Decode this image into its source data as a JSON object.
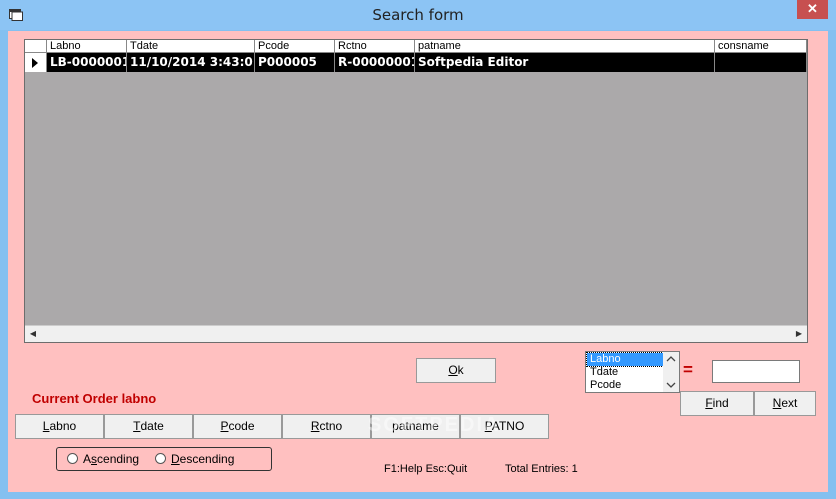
{
  "window": {
    "title": "Search form",
    "close_glyph": "✕",
    "colors": {
      "titlebar": "#8cc4f4",
      "client": "#ffc0c0",
      "accent_text": "#c00000",
      "close": "#c75050"
    }
  },
  "grid": {
    "columns": [
      "Labno",
      "Tdate",
      "Pcode",
      "Rctno",
      "patname",
      "consname"
    ],
    "rows": [
      {
        "cells": [
          "LB-0000001",
          "11/10/2014 3:43:0",
          "P000005",
          "R-00000001",
          "Softpedia Editor",
          ""
        ]
      }
    ],
    "scroll_left_glyph": "◀",
    "scroll_right_glyph": "▶"
  },
  "ok_button": {
    "label": "Ok",
    "mnemonic": "O",
    "rest": "k"
  },
  "current_order": "Current Order  labno",
  "sort_buttons": [
    {
      "label": "Labno",
      "u": "L",
      "rest": "abno"
    },
    {
      "label": "Tdate",
      "u": "T",
      "rest": "date"
    },
    {
      "label": "Pcode",
      "u": "P",
      "rest": "code"
    },
    {
      "label": "Rctno",
      "u": "R",
      "rest": "ctno"
    },
    {
      "label": "patname",
      "u": "",
      "rest": "patname"
    },
    {
      "label": "PATNO",
      "u": "P",
      "rest": "ATNO"
    }
  ],
  "order": {
    "ascending_label": "Ascending",
    "ascending_u": "s",
    "descending_label": "Descending",
    "descending_u": "D"
  },
  "search": {
    "fields": [
      "Labno",
      "Tdate",
      "Pcode"
    ],
    "selected": "Labno",
    "equals": "=",
    "value": "",
    "find_label": "Find",
    "find_u": "F",
    "next_label": "Next",
    "next_u": "N"
  },
  "status": {
    "help": "F1:Help  Esc:Quit",
    "total": "Total Entries: 1"
  },
  "watermark": "SOFTPEDIA",
  "icons": [
    "app-window-icon",
    "close-icon",
    "row-selector-arrow-icon",
    "scroll-left-icon",
    "scroll-right-icon",
    "scroll-up-icon",
    "scroll-down-icon"
  ]
}
